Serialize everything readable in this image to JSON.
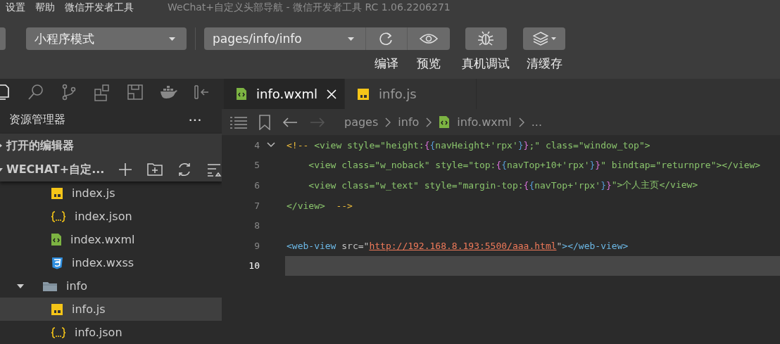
{
  "menu": [
    "设置",
    "帮助",
    "微信开发者工具"
  ],
  "window": {
    "title": "WeChat+自定义头部导航 - 微信开发者工具 RC 1.06.2206271"
  },
  "toolbar": {
    "mode": "小程序模式",
    "page": "pages/info/info",
    "actions": [
      {
        "kind": "compile",
        "label": "编译"
      },
      {
        "kind": "preview",
        "label": "预览"
      },
      {
        "kind": "debug",
        "label": "真机调试"
      },
      {
        "kind": "cache",
        "label": "清缓存"
      }
    ]
  },
  "activity_bar": [
    {
      "kind": "files",
      "selected": true
    },
    {
      "kind": "search",
      "selected": false
    },
    {
      "kind": "git",
      "selected": false
    },
    {
      "kind": "extensions",
      "selected": false
    },
    {
      "kind": "layout",
      "selected": false
    },
    {
      "kind": "docker",
      "selected": false
    },
    {
      "kind": "collapse",
      "selected": false
    }
  ],
  "sidebar": {
    "title": "资源管理器",
    "more": "•••",
    "sections": [
      {
        "label": "打开的编辑器",
        "expanded": false
      },
      {
        "label": "WECHAT+自定...",
        "expanded": true
      }
    ]
  },
  "tree": [
    {
      "children": [
        {
          "name": "index.js",
          "kind": "js",
          "selected": false
        },
        {
          "name": "index.json",
          "kind": "json",
          "selected": false
        },
        {
          "name": "index.wxml",
          "kind": "wxml",
          "selected": false
        },
        {
          "name": "index.wxss",
          "kind": "wxss",
          "selected": false
        }
      ]
    },
    {
      "name": "info",
      "kind": "folder",
      "expanded": true,
      "selected": false,
      "children": [
        {
          "name": "info.js",
          "kind": "js",
          "selected": true
        },
        {
          "name": "info.json",
          "kind": "json",
          "selected": false
        }
      ]
    }
  ],
  "tabs": [
    {
      "label": "info.wxml",
      "kind": "wxml",
      "selected": true
    },
    {
      "label": "info.js",
      "kind": "js",
      "selected": false
    }
  ],
  "breadcrumb": [
    {
      "label": "pages",
      "kind": "folder"
    },
    {
      "label": "info",
      "kind": "folder"
    },
    {
      "label": "info.wxml",
      "kind": "wxml"
    },
    {
      "label": "...",
      "kind": "more"
    }
  ],
  "code": [
    {
      "number": "4",
      "foldable": true,
      "current": false,
      "tokens": [
        {
          "kind": "punct",
          "text": "<!--"
        },
        {
          "kind": "cmt",
          "text": " <view style=\"height:"
        },
        {
          "kind": "br1",
          "text": "{"
        },
        {
          "kind": "br2",
          "text": "{"
        },
        {
          "kind": "cmt",
          "text": "navHeight+'rpx'"
        },
        {
          "kind": "br2",
          "text": "}"
        },
        {
          "kind": "br1",
          "text": "}"
        },
        {
          "kind": "cmt",
          "text": ";\" class=\"window_top\">"
        }
      ]
    },
    {
      "number": "5",
      "current": false,
      "tokens": [
        {
          "kind": "cmt",
          "text": "    <view class=\"w_noback\" style=\"top:"
        },
        {
          "kind": "br1",
          "text": "{"
        },
        {
          "kind": "br2",
          "text": "{"
        },
        {
          "kind": "cmt",
          "text": "navTop+10+'rpx'"
        },
        {
          "kind": "br2",
          "text": "}"
        },
        {
          "kind": "br1",
          "text": "}"
        },
        {
          "kind": "cmt",
          "text": "\" bindtap=\"returnpre\"></view>"
        }
      ]
    },
    {
      "number": "6",
      "current": false,
      "tokens": [
        {
          "kind": "cmt",
          "text": "    <view class=\"w_text\" style=\"margin-top:"
        },
        {
          "kind": "br1",
          "text": "{"
        },
        {
          "kind": "br2",
          "text": "{"
        },
        {
          "kind": "cmt",
          "text": "navTop+'rpx'"
        },
        {
          "kind": "br2",
          "text": "}"
        },
        {
          "kind": "br1",
          "text": "}"
        },
        {
          "kind": "cmt",
          "text": "\">个人主页</view>"
        }
      ]
    },
    {
      "number": "7",
      "current": false,
      "tokens": [
        {
          "kind": "cmt",
          "text": "</view>  "
        },
        {
          "kind": "punct",
          "text": "-->"
        }
      ]
    },
    {
      "number": "8",
      "current": false
    },
    {
      "number": "9",
      "current": false,
      "tokens": [
        {
          "kind": "tag",
          "text": "<web-view"
        },
        {
          "kind": "attr",
          "text": " src=\""
        },
        {
          "kind": "url",
          "text": "http://192.168.8.193:5500/aaa.html"
        },
        {
          "kind": "attr",
          "text": "\""
        },
        {
          "kind": "tag",
          "text": "></web-view>"
        }
      ]
    },
    {
      "number": "10",
      "current": true
    }
  ]
}
